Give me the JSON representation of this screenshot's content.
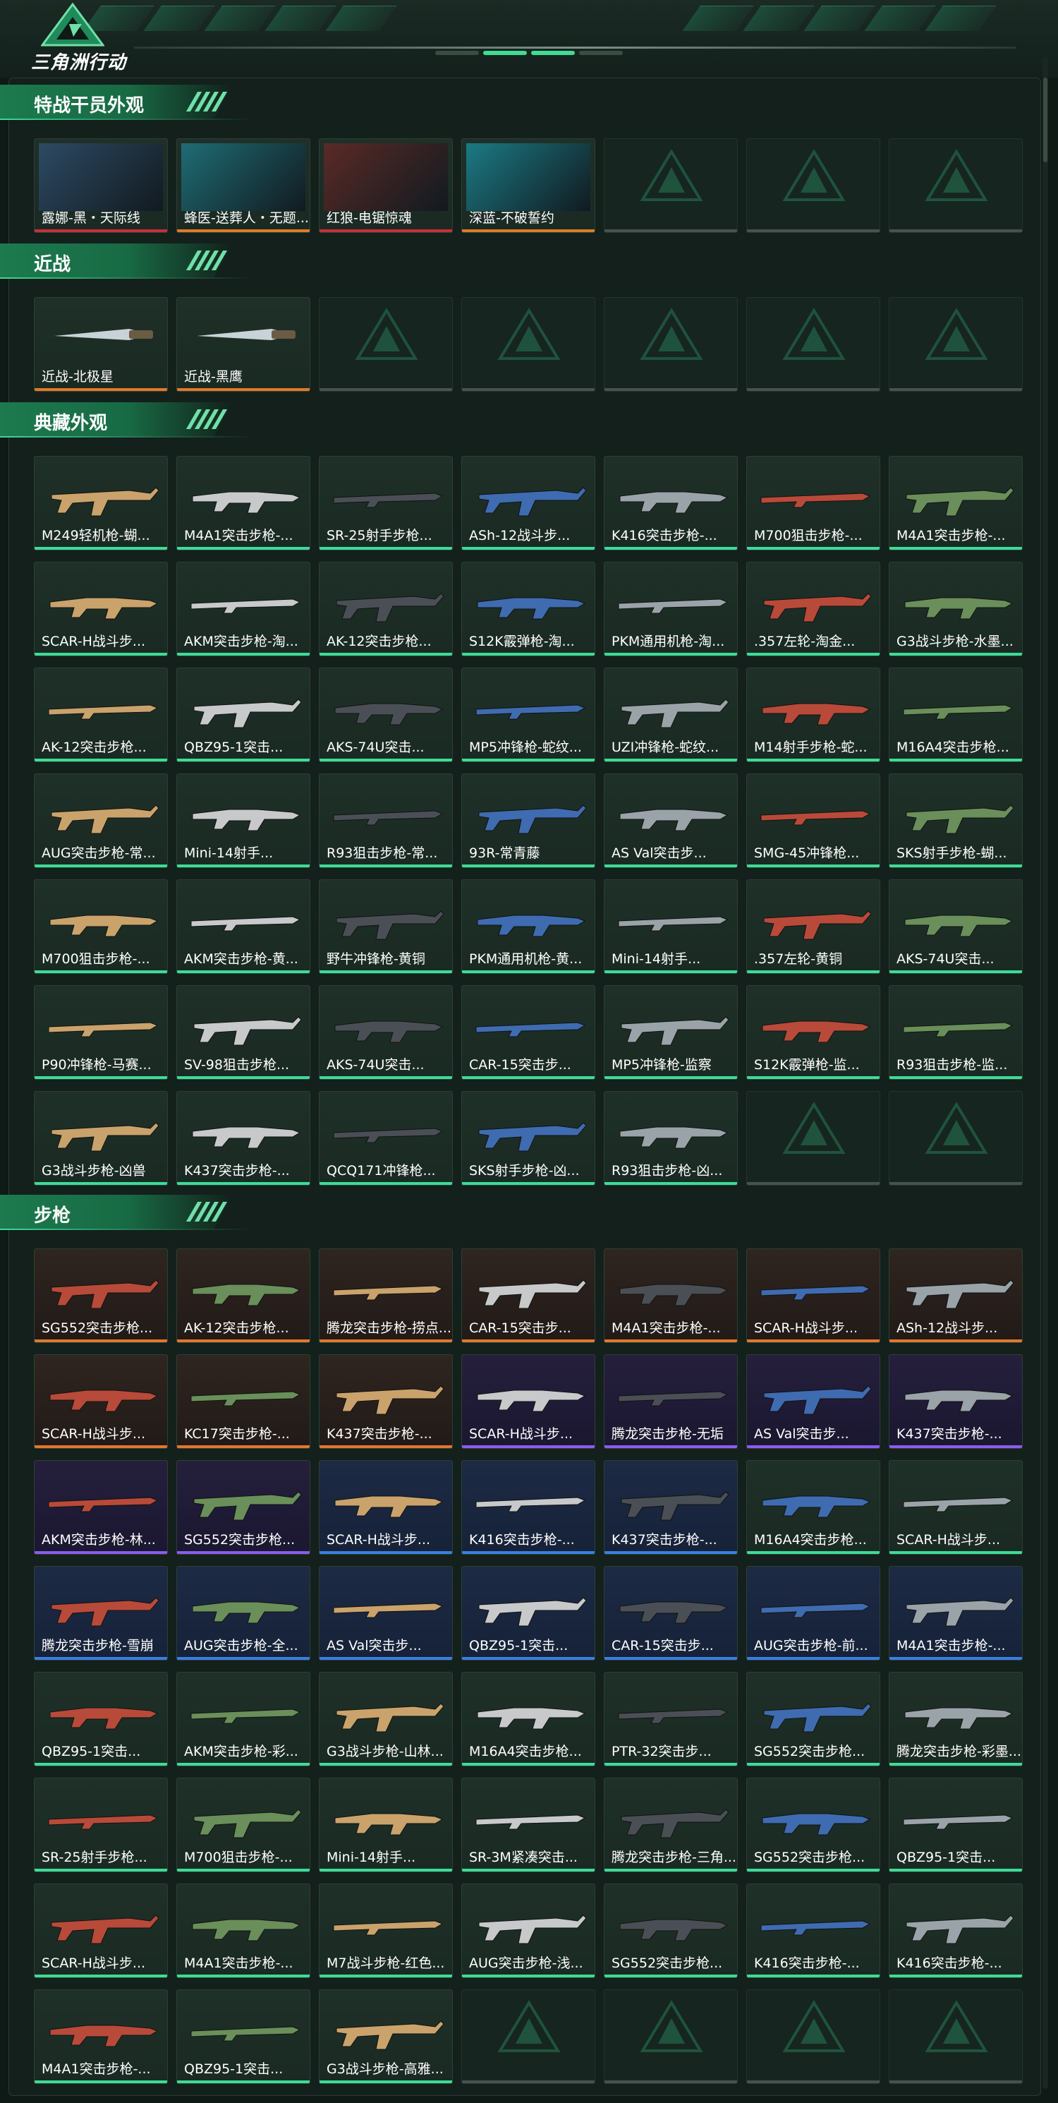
{
  "app": {
    "logo_text": "三角洲行动"
  },
  "sections": [
    {
      "title": "特战干员外观",
      "items": [
        {
          "label": "露娜-黑・天际线",
          "tone": "red"
        },
        {
          "label": "蜂医-送葬人・无题...",
          "tone": "orange"
        },
        {
          "label": "红狼-电锯惊魂",
          "tone": "red"
        },
        {
          "label": "深蓝-不破誓约",
          "tone": "orange"
        },
        {
          "label": "",
          "tone": "empty"
        },
        {
          "label": "",
          "tone": "empty"
        },
        {
          "label": "",
          "tone": "empty"
        }
      ]
    },
    {
      "title": "近战",
      "items": [
        {
          "label": "近战-北极星",
          "tone": "orange"
        },
        {
          "label": "近战-黑鹰",
          "tone": "orange"
        },
        {
          "label": "",
          "tone": "empty"
        },
        {
          "label": "",
          "tone": "empty"
        },
        {
          "label": "",
          "tone": "empty"
        },
        {
          "label": "",
          "tone": "empty"
        },
        {
          "label": "",
          "tone": "empty"
        }
      ]
    },
    {
      "title": "典藏外观",
      "items": [
        {
          "label": "M249轻机枪-蝴...",
          "tone": "green"
        },
        {
          "label": "M4A1突击步枪-...",
          "tone": "green"
        },
        {
          "label": "SR-25射手步枪...",
          "tone": "green"
        },
        {
          "label": "ASh-12战斗步...",
          "tone": "green"
        },
        {
          "label": "K416突击步枪-...",
          "tone": "green"
        },
        {
          "label": "M700狙击步枪-...",
          "tone": "green"
        },
        {
          "label": "M4A1突击步枪-...",
          "tone": "green"
        },
        {
          "label": "SCAR-H战斗步...",
          "tone": "green"
        },
        {
          "label": "AKM突击步枪-淘...",
          "tone": "green"
        },
        {
          "label": "AK-12突击步枪...",
          "tone": "green"
        },
        {
          "label": "S12K霰弹枪-淘...",
          "tone": "green"
        },
        {
          "label": "PKM通用机枪-淘...",
          "tone": "green"
        },
        {
          "label": ".357左轮-淘金...",
          "tone": "green"
        },
        {
          "label": "G3战斗步枪-水墨...",
          "tone": "green"
        },
        {
          "label": "AK-12突击步枪...",
          "tone": "green"
        },
        {
          "label": "QBZ95-1突击...",
          "tone": "green"
        },
        {
          "label": "AKS-74U突击...",
          "tone": "green"
        },
        {
          "label": "MP5冲锋枪-蛇纹...",
          "tone": "green"
        },
        {
          "label": "UZI冲锋枪-蛇纹...",
          "tone": "green"
        },
        {
          "label": "M14射手步枪-蛇...",
          "tone": "green"
        },
        {
          "label": "M16A4突击步枪...",
          "tone": "green"
        },
        {
          "label": "AUG突击步枪-常...",
          "tone": "green"
        },
        {
          "label": "Mini-14射手...",
          "tone": "green"
        },
        {
          "label": "R93狙击步枪-常...",
          "tone": "green"
        },
        {
          "label": "93R-常青藤",
          "tone": "green"
        },
        {
          "label": "AS Val突击步...",
          "tone": "green"
        },
        {
          "label": "SMG-45冲锋枪...",
          "tone": "green"
        },
        {
          "label": "SKS射手步枪-蝴...",
          "tone": "green"
        },
        {
          "label": "M700狙击步枪-...",
          "tone": "green"
        },
        {
          "label": "AKM突击步枪-黄...",
          "tone": "green"
        },
        {
          "label": "野牛冲锋枪-黄铜",
          "tone": "green"
        },
        {
          "label": "PKM通用机枪-黄...",
          "tone": "green"
        },
        {
          "label": "Mini-14射手...",
          "tone": "green"
        },
        {
          "label": ".357左轮-黄铜",
          "tone": "green"
        },
        {
          "label": "AKS-74U突击...",
          "tone": "green"
        },
        {
          "label": "P90冲锋枪-马赛...",
          "tone": "green"
        },
        {
          "label": "SV-98狙击步枪...",
          "tone": "green"
        },
        {
          "label": "AKS-74U突击...",
          "tone": "green"
        },
        {
          "label": "CAR-15突击步...",
          "tone": "green"
        },
        {
          "label": "MP5冲锋枪-监察",
          "tone": "green"
        },
        {
          "label": "S12K霰弹枪-监...",
          "tone": "green"
        },
        {
          "label": "R93狙击步枪-监...",
          "tone": "green"
        },
        {
          "label": "G3战斗步枪-凶兽",
          "tone": "green"
        },
        {
          "label": "K437突击步枪-...",
          "tone": "green"
        },
        {
          "label": "QCQ171冲锋枪...",
          "tone": "green"
        },
        {
          "label": "SKS射手步枪-凶...",
          "tone": "green"
        },
        {
          "label": "R93狙击步枪-凶...",
          "tone": "green"
        },
        {
          "label": "",
          "tone": "empty"
        },
        {
          "label": "",
          "tone": "empty"
        }
      ]
    },
    {
      "title": "步枪",
      "items": [
        {
          "label": "SG552突击步枪...",
          "tone": "warm"
        },
        {
          "label": "AK-12突击步枪...",
          "tone": "warm"
        },
        {
          "label": "腾龙突击步枪-捞点...",
          "tone": "warm"
        },
        {
          "label": "CAR-15突击步...",
          "tone": "warm"
        },
        {
          "label": "M4A1突击步枪-...",
          "tone": "warm"
        },
        {
          "label": "SCAR-H战斗步...",
          "tone": "warm"
        },
        {
          "label": "ASh-12战斗步...",
          "tone": "warm"
        },
        {
          "label": "SCAR-H战斗步...",
          "tone": "warm"
        },
        {
          "label": "KC17突击步枪-...",
          "tone": "warm"
        },
        {
          "label": "K437突击步枪-...",
          "tone": "warm"
        },
        {
          "label": "SCAR-H战斗步...",
          "tone": "purple"
        },
        {
          "label": "腾龙突击步枪-无垢",
          "tone": "purple"
        },
        {
          "label": "AS Val突击步...",
          "tone": "purple"
        },
        {
          "label": "K437突击步枪-...",
          "tone": "purple"
        },
        {
          "label": "AKM突击步枪-林...",
          "tone": "purple"
        },
        {
          "label": "SG552突击步枪...",
          "tone": "purple"
        },
        {
          "label": "SCAR-H战斗步...",
          "tone": "blue"
        },
        {
          "label": "K416突击步枪-...",
          "tone": "blue"
        },
        {
          "label": "K437突击步枪-...",
          "tone": "blue"
        },
        {
          "label": "M16A4突击步枪...",
          "tone": "green"
        },
        {
          "label": "SCAR-H战斗步...",
          "tone": "green"
        },
        {
          "label": "腾龙突击步枪-雪崩",
          "tone": "blue"
        },
        {
          "label": "AUG突击步枪-全...",
          "tone": "blue"
        },
        {
          "label": "AS Val突击步...",
          "tone": "blue"
        },
        {
          "label": "QBZ95-1突击...",
          "tone": "blue"
        },
        {
          "label": "CAR-15突击步...",
          "tone": "blue"
        },
        {
          "label": "AUG突击步枪-前...",
          "tone": "blue"
        },
        {
          "label": "M4A1突击步枪-...",
          "tone": "blue"
        },
        {
          "label": "QBZ95-1突击...",
          "tone": "green"
        },
        {
          "label": "AKM突击步枪-彩...",
          "tone": "green"
        },
        {
          "label": "G3战斗步枪-山林...",
          "tone": "green"
        },
        {
          "label": "M16A4突击步枪...",
          "tone": "green"
        },
        {
          "label": "PTR-32突击步...",
          "tone": "green"
        },
        {
          "label": "SG552突击步枪...",
          "tone": "green"
        },
        {
          "label": "腾龙突击步枪-彩墨...",
          "tone": "green"
        },
        {
          "label": "SR-25射手步枪...",
          "tone": "green"
        },
        {
          "label": "M700狙击步枪-...",
          "tone": "green"
        },
        {
          "label": "Mini-14射手...",
          "tone": "green"
        },
        {
          "label": "SR-3M紧凑突击...",
          "tone": "green"
        },
        {
          "label": "腾龙突击步枪-三角...",
          "tone": "green"
        },
        {
          "label": "SG552突击步枪...",
          "tone": "green"
        },
        {
          "label": "QBZ95-1突击...",
          "tone": "green"
        },
        {
          "label": "SCAR-H战斗步...",
          "tone": "green"
        },
        {
          "label": "M4A1突击步枪-...",
          "tone": "green"
        },
        {
          "label": "M7战斗步枪-红色...",
          "tone": "green"
        },
        {
          "label": "AUG突击步枪-浅...",
          "tone": "green"
        },
        {
          "label": "SG552突击步枪...",
          "tone": "green"
        },
        {
          "label": "K416突击步枪-...",
          "tone": "green"
        },
        {
          "label": "K416突击步枪-...",
          "tone": "green"
        },
        {
          "label": "M4A1突击步枪-...",
          "tone": "green"
        },
        {
          "label": "QBZ95-1突击...",
          "tone": "green"
        },
        {
          "label": "G3战斗步枪-高雅...",
          "tone": "green"
        },
        {
          "label": "",
          "tone": "empty"
        },
        {
          "label": "",
          "tone": "empty"
        },
        {
          "label": "",
          "tone": "empty"
        },
        {
          "label": "",
          "tone": "empty"
        }
      ]
    }
  ]
}
